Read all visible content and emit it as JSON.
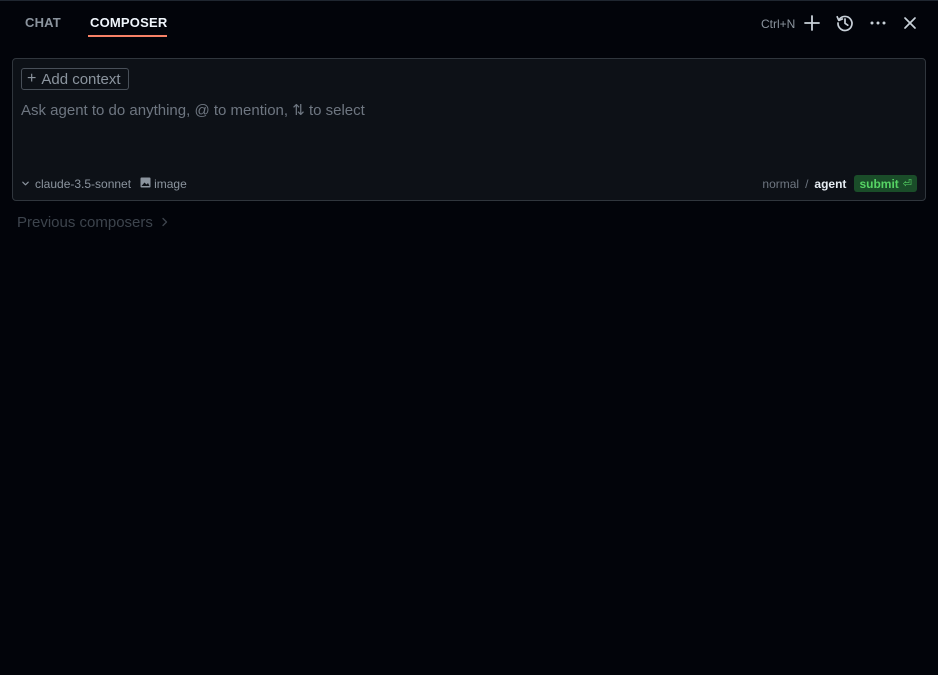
{
  "header": {
    "tabs": [
      {
        "label": "CHAT",
        "active": false
      },
      {
        "label": "COMPOSER",
        "active": true
      }
    ],
    "new_shortcut": "Ctrl+N",
    "icons": [
      "plus-icon",
      "history-icon",
      "more-icon",
      "close-icon"
    ]
  },
  "composer": {
    "add_context_label": "Add context",
    "placeholder": "Ask agent to do anything, @ to mention, ⇅ to select",
    "model": "claude-3.5-sonnet",
    "image_label": "image",
    "modes": {
      "normal": "normal",
      "separator": "/",
      "agent": "agent"
    },
    "submit_label": "submit",
    "submit_symbol": "⏎"
  },
  "previous_composers_label": "Previous composers",
  "colors": {
    "background": "#02040a",
    "box": "#0d1117",
    "accent_underline": "#f78166",
    "submit_bg": "#1a4d29",
    "submit_text": "#56d364"
  }
}
